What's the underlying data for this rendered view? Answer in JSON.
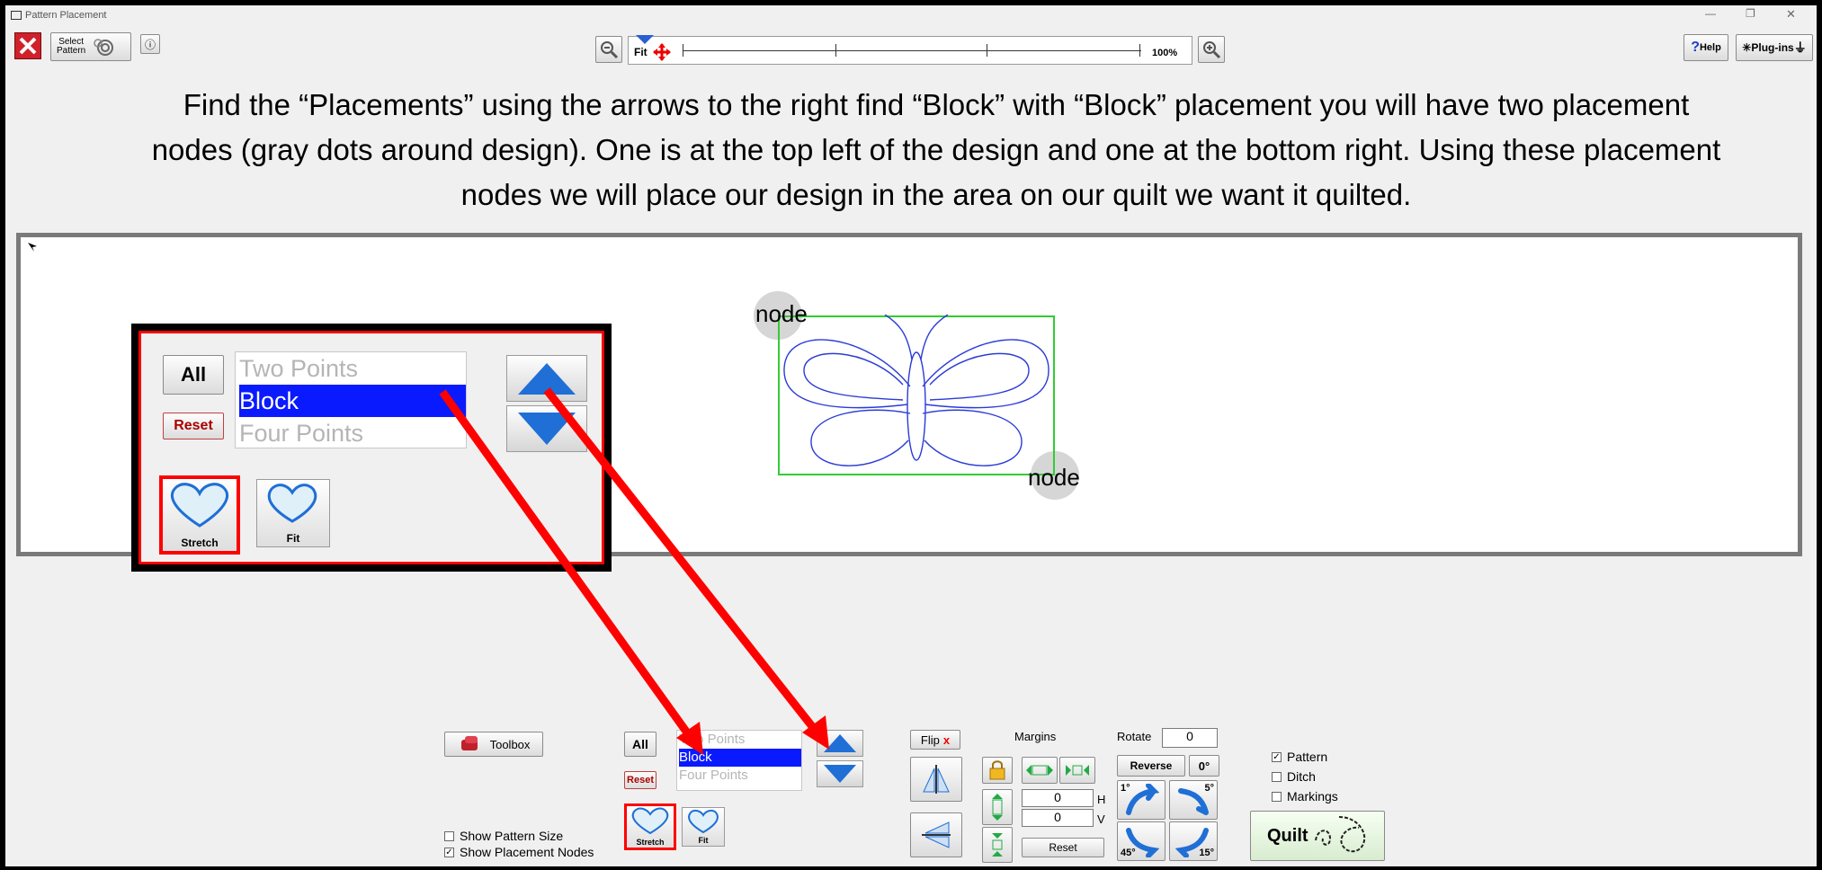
{
  "window": {
    "title": "Pattern Placement"
  },
  "toolbar": {
    "select_pattern_line1": "Select",
    "select_pattern_line2": "Pattern",
    "fit_label": "Fit",
    "zoom_label": "100%",
    "help_label": "Help",
    "plugins_label": "Plug-ins"
  },
  "caption": "Find the “Placements” using the arrows to the right find “Block” with “Block” placement you will have two placement nodes (gray dots around design).  One is at the top left of the design and one at the bottom right.   Using these placement nodes we will place our design in the area on our quilt we want it quilted.",
  "canvas": {
    "node_top_label": "node",
    "node_bottom_label": "node"
  },
  "callout": {
    "all_label": "All",
    "reset_label": "Reset",
    "placements": [
      "Two Points",
      "Block",
      "Four Points"
    ],
    "selected": "Block",
    "stretch_label": "Stretch",
    "fit_label": "Fit"
  },
  "bottom": {
    "toolbox_label": "Toolbox",
    "all_label": "All",
    "reset_label": "Reset",
    "placements": [
      "Two Points",
      "Block",
      "Four Points"
    ],
    "stretch_label": "Stretch",
    "fit_label": "Fit",
    "show_pattern_size": "Show Pattern Size",
    "show_placement_nodes": "Show Placement Nodes",
    "flip_label": "Flip",
    "margins_label": "Margins",
    "margin_h_value": "0",
    "margin_v_value": "0",
    "h_label": "H",
    "v_label": "V",
    "margins_reset_label": "Reset",
    "rotate_label": "Rotate",
    "rotate_value": "0",
    "reverse_label": "Reverse",
    "zero_deg_label": "0°",
    "rot_1": "1°",
    "rot_5": "5°",
    "rot_45": "45°",
    "rot_15": "15°",
    "pattern_label": "Pattern",
    "ditch_label": "Ditch",
    "markings_label": "Markings",
    "quilt_label": "Quilt"
  },
  "colors": {
    "accent_red": "#ff0000",
    "select_blue": "#0a1aff",
    "arrow_blue": "#1f6fd6",
    "outline_green": "#33cc33"
  }
}
